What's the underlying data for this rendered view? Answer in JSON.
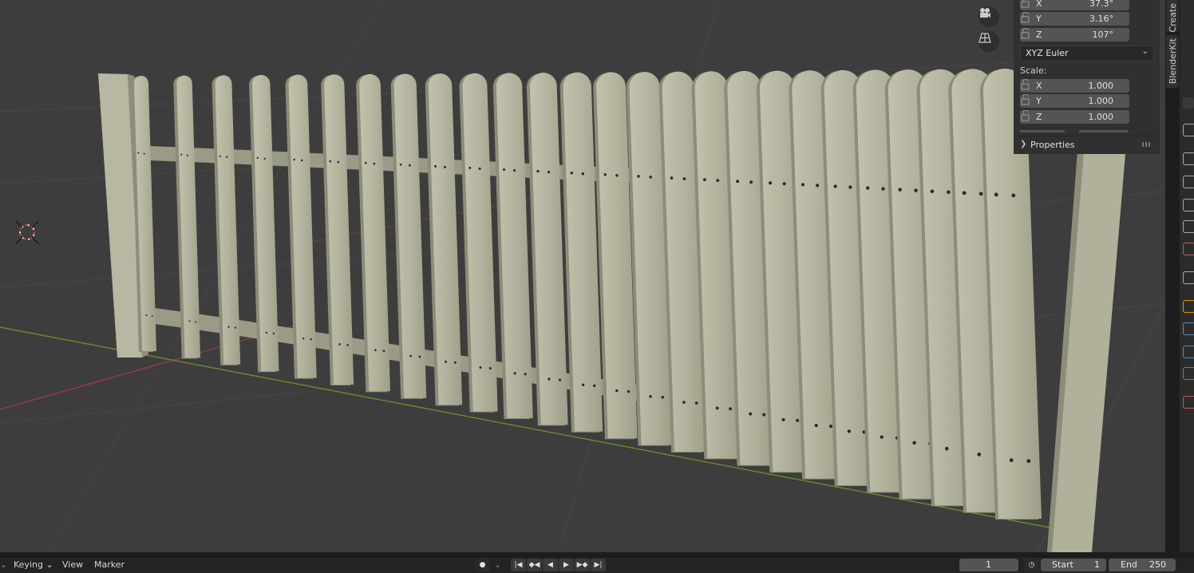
{
  "rotation": {
    "x": {
      "axis": "X",
      "value": "37.3°"
    },
    "y": {
      "axis": "Y",
      "value": "3.16°"
    },
    "z": {
      "axis": "Z",
      "value": "107°"
    },
    "mode": "XYZ Euler"
  },
  "scale": {
    "label": "Scale:",
    "x": {
      "axis": "X",
      "value": "1.000"
    },
    "y": {
      "axis": "Y",
      "value": "1.000"
    },
    "z": {
      "axis": "Z",
      "value": "1.000"
    }
  },
  "properties_panel": {
    "label": "Properties"
  },
  "side_tabs": {
    "create": "Create",
    "blenderkit": "BlenderKit"
  },
  "viewport_icons": [
    "camera-icon",
    "grid-icon"
  ],
  "timeline": {
    "menus": {
      "keying": "Keying",
      "view": "View",
      "marker": "Marker"
    },
    "current_frame": "1",
    "start_label": "Start",
    "start_value": "1",
    "end_label": "End",
    "end_value": "250"
  },
  "colors": {
    "viewport_bg": "#3d3d3d",
    "fence": "#aeae98",
    "x_axis": "#9a3a44",
    "y_axis": "#6f8a2a"
  }
}
